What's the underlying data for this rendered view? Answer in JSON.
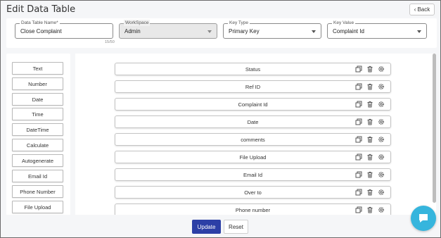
{
  "page": {
    "title": "Edit Data Table",
    "back_label": "Back"
  },
  "form": {
    "data_table_name": {
      "label": "Data Table Name*",
      "value": "Close Complaint",
      "counter": "15/50"
    },
    "workspace": {
      "label": "WorkSpace",
      "value": "Admin",
      "disabled": true
    },
    "key_type": {
      "label": "Key Type",
      "value": "Primary Key"
    },
    "key_value": {
      "label": "Key Value",
      "value": "Complaint Id"
    }
  },
  "field_types": [
    "Text",
    "Number",
    "Date",
    "Time",
    "DateTime",
    "Calculate",
    "Autogenerate",
    "Email Id",
    "Phone Number",
    "File Upload"
  ],
  "fields": [
    "Status",
    "Ref ID",
    "Complaint Id",
    "Date",
    "comments",
    "File Upload",
    "Email Id",
    "Over to",
    "Phone number"
  ],
  "field_actions": [
    "copy-icon",
    "trash-icon",
    "gear-icon"
  ],
  "actions": {
    "update_label": "Update",
    "reset_label": "Reset"
  },
  "colors": {
    "primary": "#2c3fa6",
    "chat": "#36b5dd",
    "background": "#f5f6f8"
  }
}
